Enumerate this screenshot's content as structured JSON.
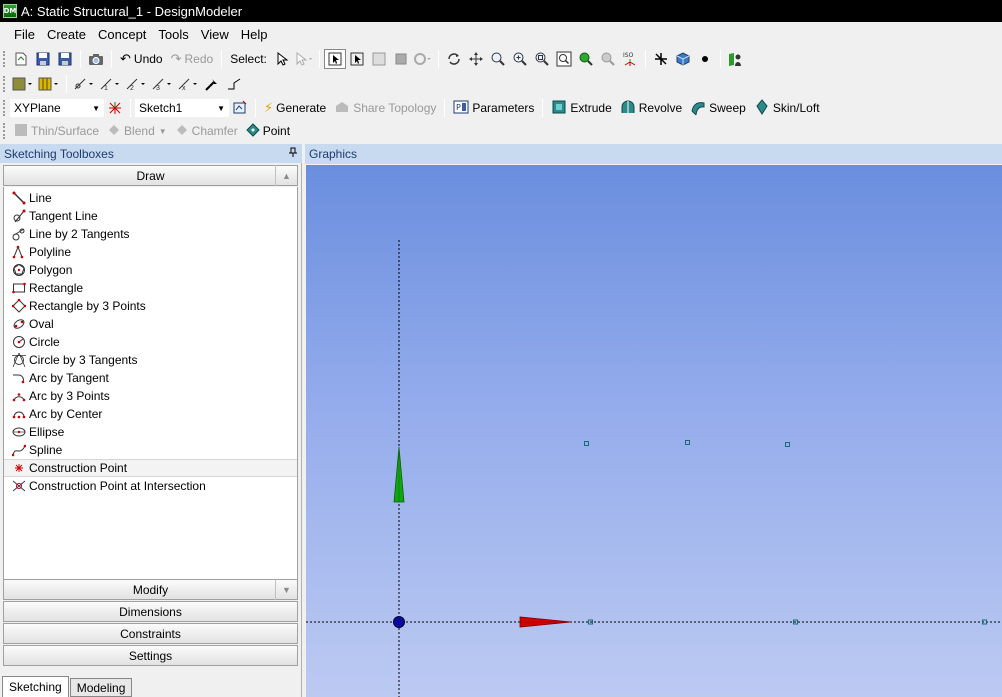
{
  "window": {
    "title": "A: Static Structural_1 - DesignModeler",
    "app_icon_text": "DM"
  },
  "menu": [
    "File",
    "Create",
    "Concept",
    "Tools",
    "View",
    "Help"
  ],
  "toolbar_main": {
    "undo": "Undo",
    "redo": "Redo",
    "select_label": "Select:"
  },
  "toolbar_sketch": {
    "plane": "XYPlane",
    "sketch": "Sketch1",
    "generate": "Generate",
    "share_topology": "Share Topology",
    "parameters": "Parameters",
    "extrude": "Extrude",
    "revolve": "Revolve",
    "sweep": "Sweep",
    "skin_loft": "Skin/Loft"
  },
  "toolbar_features": {
    "thin_surface": "Thin/Surface",
    "blend": "Blend",
    "chamfer": "Chamfer",
    "point": "Point"
  },
  "left_panel": {
    "title": "Sketching Toolboxes",
    "draw_header": "Draw",
    "draw_items": [
      "Line",
      "Tangent Line",
      "Line by 2 Tangents",
      "Polyline",
      "Polygon",
      "Rectangle",
      "Rectangle by 3 Points",
      "Oval",
      "Circle",
      "Circle by 3 Tangents",
      "Arc by Tangent",
      "Arc by 3 Points",
      "Arc by Center",
      "Ellipse",
      "Spline",
      "Construction Point",
      "Construction Point at Intersection"
    ],
    "selected_item": "Construction Point",
    "sections": [
      "Modify",
      "Dimensions",
      "Constraints",
      "Settings"
    ],
    "tabs": [
      "Sketching",
      "Modeling"
    ],
    "active_tab": "Sketching"
  },
  "graphics": {
    "title": "Graphics"
  },
  "colors": {
    "title_bar": "#000000",
    "panel_header": "#c8daf0",
    "viewport_top": "#6a8ede",
    "viewport_bottom": "#bccaf2",
    "x_axis": "#d40000",
    "y_axis": "#0a9a0a",
    "origin": "#0a0aa0"
  }
}
